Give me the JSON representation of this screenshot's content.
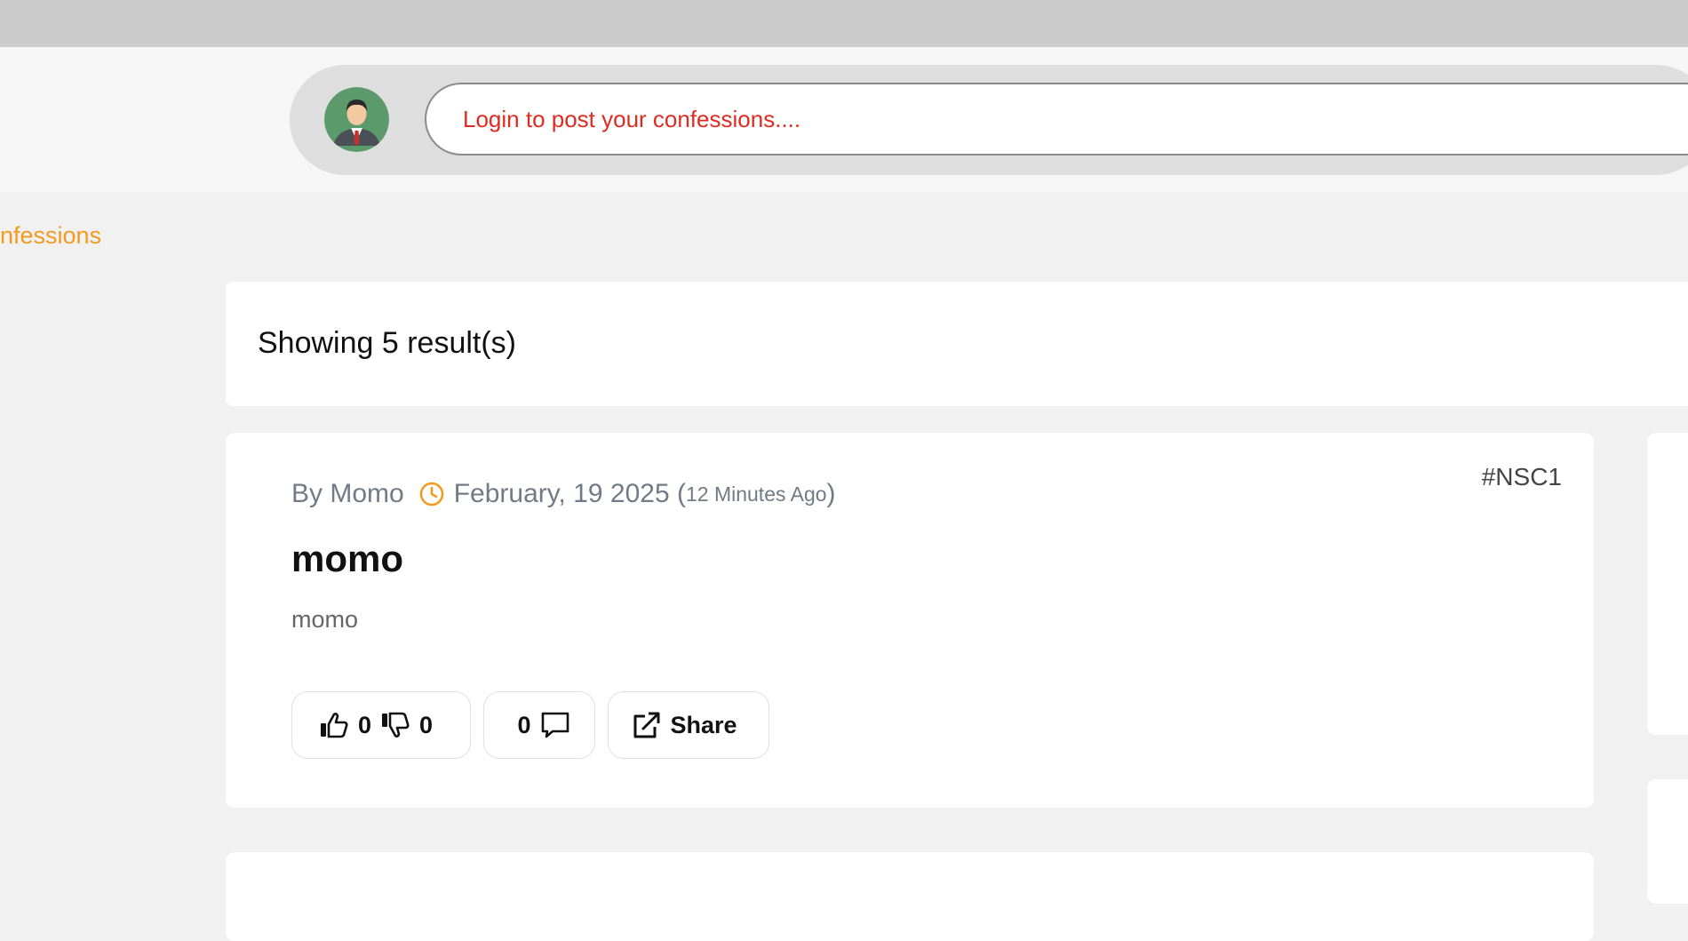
{
  "header": {
    "avatar_icon": "user-avatar-icon",
    "login_placeholder": "Login to post your confessions...."
  },
  "nav": {
    "confessions_link": "nfessions"
  },
  "results": {
    "summary": "Showing 5 result(s)"
  },
  "posts": [
    {
      "by_label": "By",
      "author": "Momo",
      "date": "February, 19 2025",
      "ago": "12 Minutes Ago",
      "tag": "#NSC1",
      "title": "momo",
      "body": "momo",
      "likes": "0",
      "dislikes": "0",
      "comments": "0",
      "share_label": "Share"
    }
  ],
  "colors": {
    "accent_orange": "#f39a1e",
    "login_red": "#e02b20",
    "meta_gray": "#717b85"
  },
  "icons": [
    "clock-icon",
    "thumbs-up-icon",
    "thumbs-down-icon",
    "comment-icon",
    "share-icon"
  ]
}
